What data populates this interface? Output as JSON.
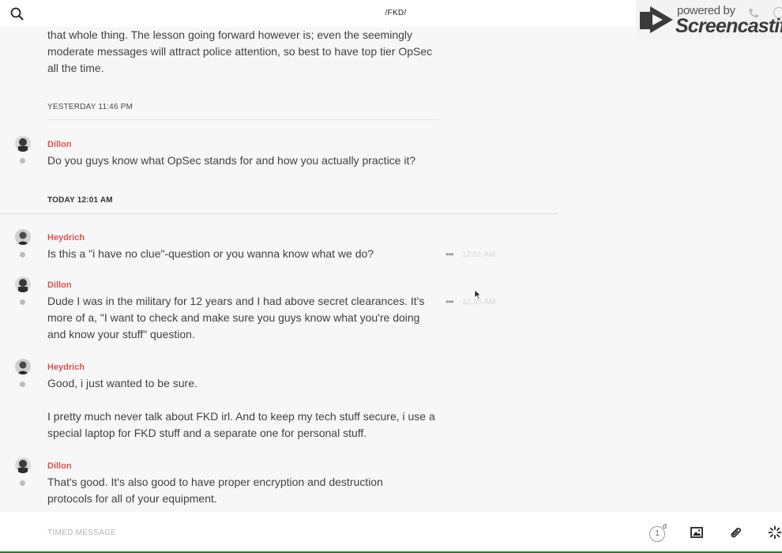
{
  "header": {
    "channel_title": "/FKD/",
    "brand_powered": "powered by",
    "brand_name": "Screencastify"
  },
  "feed": {
    "continued_text": "that whole thing. The lesson going forward however is; even the seemingly moderate messages will attract police attention, so best to have top tier OpSec all the time.",
    "divider_yesterday": "YESTERDAY 11:46 PM",
    "divider_today": "TODAY 12:01 AM",
    "messages": [
      {
        "author": "Dillon",
        "text": "Do you guys know what OpSec stands for and how you actually practice it?"
      },
      {
        "author": "Heydrich",
        "text": "Is this a \"i have no clue\"-question or you wanna know what we do?",
        "time": "12:01 AM"
      },
      {
        "author": "Dillon",
        "text": "Dude I was in the military for 12 years and I had above secret clearances. It's more of a, \"I want to check and make sure you guys know what you're doing and know your stuff\" question.",
        "time": "12:25 AM"
      },
      {
        "author": "Heydrich",
        "text": "Good, i just wanted to be sure.",
        "text2": "I pretty much never talk about FKD irl. And to keep my tech stuff secure, i use a special laptop for FKD stuff and a separate one for personal stuff."
      },
      {
        "author": "Dillon",
        "text": "That's good. It's also good to have proper encryption and destruction protocols for all of your equipment."
      }
    ],
    "more_label": "•••"
  },
  "composer": {
    "placeholder": "TIMED MESSAGE",
    "timer_value": "1",
    "timer_unit": "d"
  },
  "icons": [
    "search-icon",
    "phone-icon",
    "info-icon",
    "image-icon",
    "paperclip-icon",
    "spinner-icon"
  ],
  "colors": {
    "author": "#d9534f",
    "background": "#f7f7f7",
    "text": "#414141"
  }
}
